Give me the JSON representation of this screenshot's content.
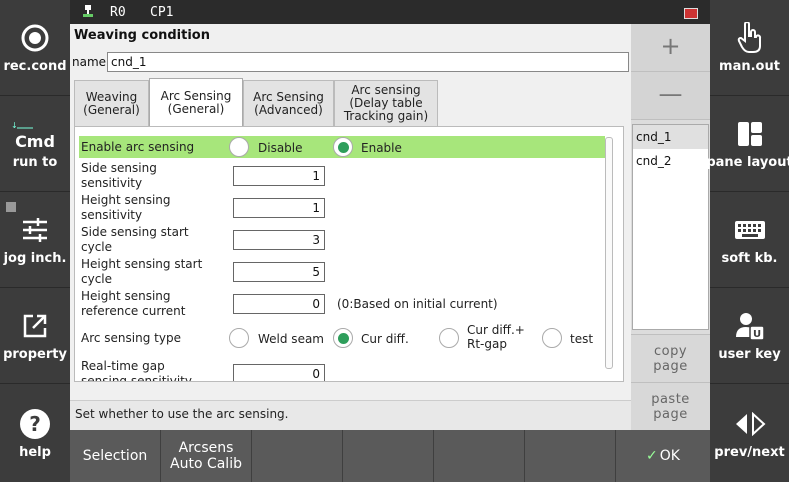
{
  "statusbar": {
    "robot_id": "R0",
    "cp": "CP1"
  },
  "left_rail": [
    {
      "label": "rec.cond",
      "icon": "record-circle-icon"
    },
    {
      "label": "run to",
      "big": "Cmd",
      "icon": "run-to-icon"
    },
    {
      "label": "jog inch.",
      "icon": "sliders-icon"
    },
    {
      "label": "property",
      "icon": "external-link-icon"
    },
    {
      "label": "help",
      "icon": "help-question-icon"
    }
  ],
  "right_rail": [
    {
      "label": "man.out",
      "icon": "hand-pointer-icon"
    },
    {
      "label": "pane layout",
      "icon": "pane-layout-icon"
    },
    {
      "label": "soft kb.",
      "icon": "keyboard-icon"
    },
    {
      "label": "user key",
      "icon": "user-key-icon"
    },
    {
      "label": "prev/next",
      "icon": "prev-next-icon"
    }
  ],
  "dialog": {
    "title": "Weaving condition",
    "name_label": "name",
    "name_value": "cnd_1",
    "tabs": [
      {
        "label": "Weaving\n(General)"
      },
      {
        "label": "Arc Sensing\n(General)"
      },
      {
        "label": "Arc Sensing\n(Advanced)"
      },
      {
        "label": "Arc sensing\n(Delay table\nTracking gain)"
      }
    ],
    "rows": {
      "enable": {
        "label": "Enable arc sensing",
        "opt1": "Disable",
        "opt2": "Enable"
      },
      "side_sens": {
        "label": "Side sensing\nsensitivity",
        "value": "1"
      },
      "height_sens": {
        "label": "Height sensing\nsensitivity",
        "value": "1"
      },
      "side_start": {
        "label": "Side sensing start\ncycle",
        "value": "3"
      },
      "height_start": {
        "label": "Height sensing start\ncycle",
        "value": "5"
      },
      "height_ref": {
        "label": "Height sensing\nreference current",
        "value": "0",
        "note": "(0:Based on initial current)"
      },
      "type": {
        "label": "Arc sensing type",
        "opt1": "Weld seam",
        "opt2": "Cur diff.",
        "opt3": "Cur diff.+\nRt-gap",
        "opt4": "test"
      },
      "realtime": {
        "label": "Real-time gap\nsensing sensitivity",
        "value": "0"
      }
    },
    "hint": "Set whether to use the arc sensing."
  },
  "mini": {
    "plus": "+",
    "minus": "—",
    "items": [
      "cnd_1",
      "cnd_2"
    ],
    "copy": "copy\npage",
    "paste": "paste\npage"
  },
  "fkeys": [
    "Selection",
    "Arcsens\nAuto Calib",
    "",
    "",
    "",
    "",
    "OK"
  ]
}
